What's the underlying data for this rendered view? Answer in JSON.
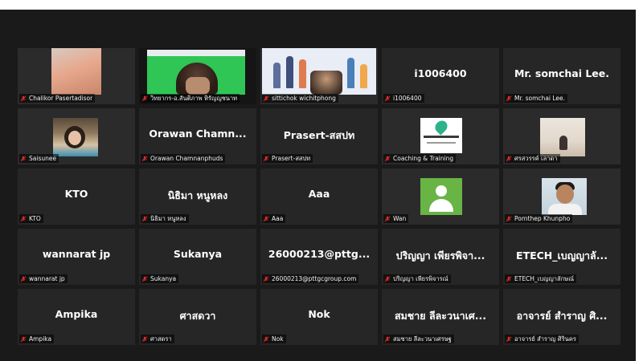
{
  "participants": [
    {
      "label": "Chalikor Pasertadisor",
      "display": "",
      "video": "face-warm"
    },
    {
      "label": "วิทยากร-อ.สันติภาพ หิรัญญชนาท",
      "display": "",
      "video": "green-screen"
    },
    {
      "label": "sittichok wichitphong",
      "display": "",
      "video": "presentation"
    },
    {
      "label": "i1006400",
      "display": "i1006400",
      "video": ""
    },
    {
      "label": "Mr. somchai Lee.",
      "display": "Mr. somchai Lee.",
      "video": ""
    },
    {
      "label": "Saisunee",
      "display": "",
      "video": "woman"
    },
    {
      "label": "Orawan Chamnanphuds",
      "display": "Orawan  Chamn...",
      "video": ""
    },
    {
      "label": "Prasert-สสปท",
      "display": "Prasert-สสปท",
      "video": ""
    },
    {
      "label": "Coaching & Training",
      "display": "",
      "video": "logo"
    },
    {
      "label": "ศรสวรรค์ เลาดา",
      "display": "",
      "video": "room"
    },
    {
      "label": "KTO",
      "display": "KTO",
      "video": ""
    },
    {
      "label": "นิธิมา หนูหลง",
      "display": "นิธิมา หนูหลง",
      "video": ""
    },
    {
      "label": "Aaa",
      "display": "Aaa",
      "video": ""
    },
    {
      "label": "Wan",
      "display": "",
      "video": "avatar"
    },
    {
      "label": "Pornthep Khunpho",
      "display": "",
      "video": "man"
    },
    {
      "label": "wannarat jp",
      "display": "wannarat jp",
      "video": ""
    },
    {
      "label": "Sukanya",
      "display": "Sukanya",
      "video": ""
    },
    {
      "label": "26000213@pttgcgroup.com",
      "display": "26000213@pttg...",
      "video": ""
    },
    {
      "label": "ปริญญา เพียรพิจารณ์",
      "display": "ปริญญา เพียรพิจา...",
      "video": ""
    },
    {
      "label": "ETECH_เบญญาลักษณ์",
      "display": "ETECH_เบญญาลั...",
      "video": ""
    },
    {
      "label": "Ampika",
      "display": "Ampika",
      "video": ""
    },
    {
      "label": "ศาสดรา",
      "display": "ศาสดวา",
      "video": ""
    },
    {
      "label": "Nok",
      "display": "Nok",
      "video": ""
    },
    {
      "label": "สมชาย ลีละวนาเศรษฐ",
      "display": "สมชาย ลีละวนาเศ...",
      "video": ""
    },
    {
      "label": "อาจารย์ สำราญ ศิรินคร",
      "display": "อาจารย์ สำราญ ศิ...",
      "video": ""
    }
  ],
  "colors": {
    "stage": "#1a1a1a",
    "tile": "#262626",
    "mic_muted": "#e02b2b"
  },
  "icons": {
    "mic": "mic-muted-icon"
  }
}
